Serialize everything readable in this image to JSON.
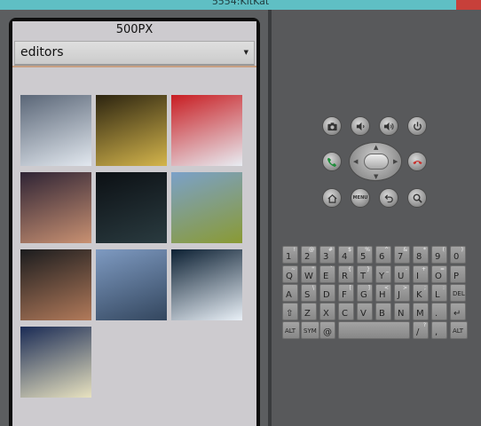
{
  "window": {
    "title": "5554:KitKat"
  },
  "app": {
    "title": "500PX",
    "feature_selector": {
      "value": "editors"
    },
    "photos": [
      {
        "name": "photo-snowy-forest",
        "colors": [
          "#5a6677",
          "#e2e8ef"
        ]
      },
      {
        "name": "photo-tree-tunnel",
        "colors": [
          "#2c2410",
          "#d4b54c"
        ]
      },
      {
        "name": "photo-flag-on-ice",
        "colors": [
          "#c81d22",
          "#e8edf3"
        ]
      },
      {
        "name": "photo-blurred-dusk",
        "colors": [
          "#2f2435",
          "#c99172"
        ]
      },
      {
        "name": "photo-dark-figure",
        "colors": [
          "#0c1014",
          "#2a3b40"
        ]
      },
      {
        "name": "photo-lion-field",
        "colors": [
          "#7ba1c9",
          "#8a9a33"
        ]
      },
      {
        "name": "photo-miner-portrait",
        "colors": [
          "#1b1c1e",
          "#b27a5a"
        ]
      },
      {
        "name": "photo-lake-island",
        "colors": [
          "#7e9ac1",
          "#33465e"
        ]
      },
      {
        "name": "photo-skier",
        "colors": [
          "#0c2033",
          "#e9f0f7"
        ]
      },
      {
        "name": "photo-symmetry-art",
        "colors": [
          "#1a2b55",
          "#e8e2c0"
        ]
      }
    ]
  },
  "emulator": {
    "keyboard": [
      [
        [
          "1",
          "!"
        ],
        [
          "2",
          "@"
        ],
        [
          "3",
          "#"
        ],
        [
          "4",
          "$"
        ],
        [
          "5",
          "%"
        ],
        [
          "6",
          "^"
        ],
        [
          "7",
          "&"
        ],
        [
          "8",
          "*"
        ],
        [
          "9",
          "("
        ],
        [
          "0",
          ")"
        ]
      ],
      [
        [
          "Q",
          "~"
        ],
        [
          "W",
          "\""
        ],
        [
          "E",
          "`"
        ],
        [
          "R",
          "{"
        ],
        [
          "T",
          "}"
        ],
        [
          "Y",
          "_"
        ],
        [
          "U",
          "-"
        ],
        [
          "I",
          "+"
        ],
        [
          "O",
          "="
        ],
        [
          "P",
          ""
        ]
      ],
      [
        [
          "A",
          ""
        ],
        [
          "S",
          "\\"
        ],
        [
          "D",
          ""
        ],
        [
          "F",
          "["
        ],
        [
          "G",
          "]"
        ],
        [
          "H",
          "<"
        ],
        [
          "J",
          ">"
        ],
        [
          "K",
          ";"
        ],
        [
          "L",
          ":"
        ],
        [
          "DEL",
          ""
        ]
      ],
      [
        [
          "⇧",
          ""
        ],
        [
          "Z",
          ""
        ],
        [
          "X",
          ""
        ],
        [
          "C",
          ""
        ],
        [
          "V",
          ""
        ],
        [
          "B",
          ""
        ],
        [
          "N",
          ""
        ],
        [
          "M",
          ""
        ],
        [
          ".",
          ""
        ],
        [
          "↵",
          ""
        ]
      ],
      [
        [
          "ALT",
          ""
        ],
        [
          "SYM",
          ""
        ],
        [
          "@",
          ""
        ],
        [
          "",
          ""
        ],
        [
          "/",
          "?"
        ],
        [
          ",",
          ""
        ],
        [
          "ALT",
          ""
        ]
      ]
    ],
    "menu_label": "MENU"
  }
}
